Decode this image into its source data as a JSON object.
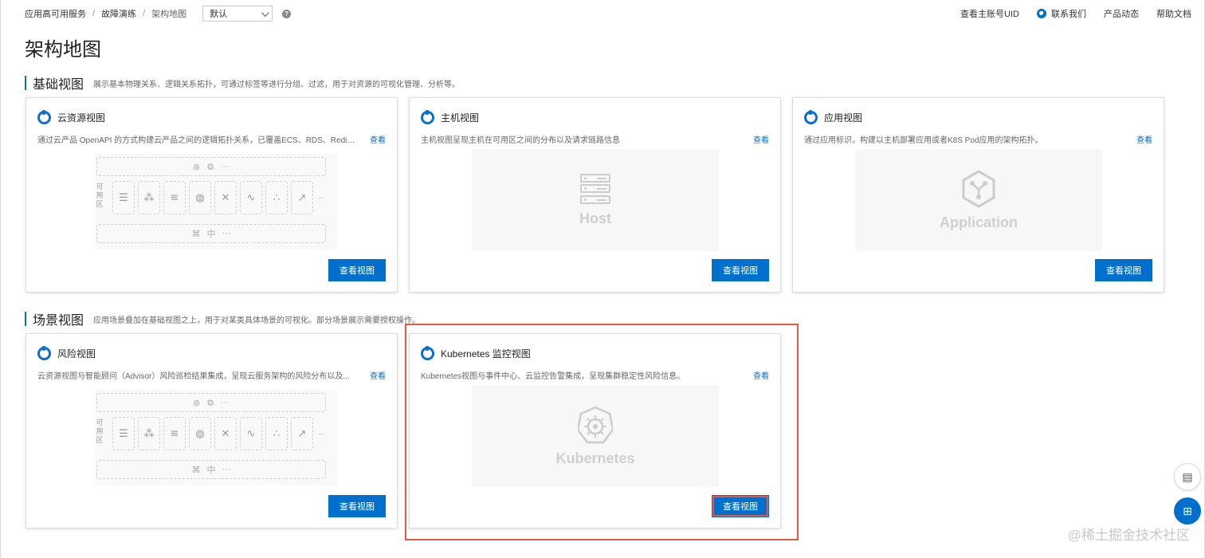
{
  "breadcrumb": {
    "items": [
      "应用高可用服务",
      "故障演练",
      "架构地图"
    ],
    "separator": "/"
  },
  "view_select": {
    "value": "默认"
  },
  "top_nav": {
    "account_uid": "查看主账号UID",
    "contact": "联系我们",
    "product_news": "产品动态",
    "help_docs": "帮助文档"
  },
  "page_title": "架构地图",
  "sections": {
    "basic": {
      "title": "基础视图",
      "desc": "展示基本物理关系、逻辑关系拓扑，可通过标签等进行分组、过滤，用于对资源的可视化管理、分析等。"
    },
    "scene": {
      "title": "场景视图",
      "desc": "应用场景叠加在基础视图之上，用于对某类具体场景的可视化。部分场景展示需要授权操作。"
    }
  },
  "cards": {
    "cloud": {
      "title": "云资源视图",
      "desc": "通过云产品 OpenAPI 的方式构建云产品之间的逻辑拓扑关系，已覆盖ECS、RDS、Redis...",
      "link": "查看",
      "button": "查看视图"
    },
    "host": {
      "title": "主机视图",
      "desc": "主机视图呈现主机在可用区之间的分布以及请求链路信息",
      "link": "查看",
      "button": "查看视图",
      "preview_text": "Host"
    },
    "app": {
      "title": "应用视图",
      "desc": "通过应用标识，构建以主机部署应用或者K8S Pod应用的架构拓扑。",
      "link": "查看",
      "button": "查看视图",
      "preview_text": "Application"
    },
    "risk": {
      "title": "风险视图",
      "desc": "云资源视图与智能顾问（Advisor）风险巡检结果集成，呈现云服务架构的风险分布以及...",
      "link": "查看",
      "button": "查看视图"
    },
    "k8s": {
      "title": "Kubernetes 监控视图",
      "desc": "Kubernetes视图与事件中心、云监控告警集成，呈现集群稳定性风险信息。",
      "link": "查看",
      "button": "查看视图",
      "preview_text": "Kubernetes"
    }
  },
  "diagram": {
    "az_label": "可用区",
    "ellipsis": "···",
    "trailing": "..."
  },
  "watermark": "@稀土掘金技术社区",
  "colors": {
    "accent": "#0070cc",
    "highlight": "#e8573f"
  }
}
